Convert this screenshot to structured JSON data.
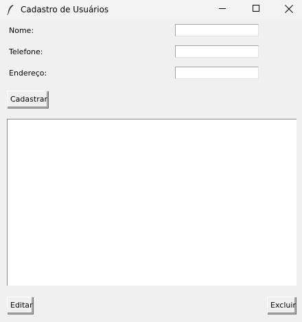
{
  "window": {
    "title": "Cadastro de Usuários",
    "app_icon": "feather-icon",
    "controls": [
      "minimize-icon",
      "maximize-icon",
      "close-icon"
    ]
  },
  "form": {
    "nome_label": "Nome:",
    "nome_value": "",
    "telefone_label": "Telefone:",
    "telefone_value": "",
    "endereco_label": "Endereço:",
    "endereco_value": ""
  },
  "buttons": {
    "cadastrar": "Cadastrar",
    "editar": "Editar",
    "excluir": "Excluir"
  },
  "list": {
    "items": []
  }
}
